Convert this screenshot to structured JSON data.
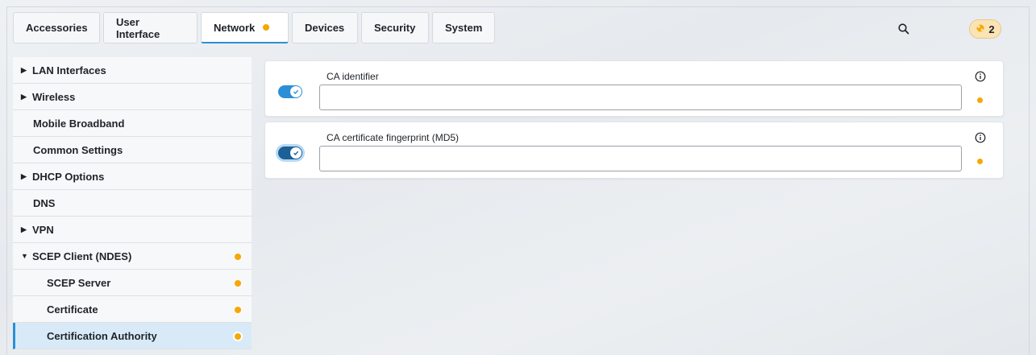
{
  "tabs": [
    {
      "label": "Accessories",
      "active": false,
      "modified": false
    },
    {
      "label": "User Interface",
      "active": false,
      "modified": false
    },
    {
      "label": "Network",
      "active": true,
      "modified": true
    },
    {
      "label": "Devices",
      "active": false,
      "modified": false
    },
    {
      "label": "Security",
      "active": false,
      "modified": false
    },
    {
      "label": "System",
      "active": false,
      "modified": false
    }
  ],
  "header": {
    "search_icon": "search-icon",
    "changes_count": "2"
  },
  "sidebar": {
    "items": [
      {
        "label": "LAN Interfaces",
        "expandable": "collapsed"
      },
      {
        "label": "Wireless",
        "expandable": "collapsed"
      },
      {
        "label": "Mobile Broadband"
      },
      {
        "label": "Common Settings"
      },
      {
        "label": "DHCP Options",
        "expandable": "collapsed"
      },
      {
        "label": "DNS"
      },
      {
        "label": "VPN",
        "expandable": "collapsed"
      },
      {
        "label": "SCEP Client (NDES)",
        "expandable": "expanded",
        "modified": true
      },
      {
        "label": "SCEP Server",
        "child": true,
        "modified": true
      },
      {
        "label": "Certificate",
        "child": true,
        "modified": true
      },
      {
        "label": "Certification Authority",
        "child": true,
        "modified": true,
        "selected": true
      }
    ]
  },
  "settings": [
    {
      "label": "CA identifier",
      "value": "",
      "enabled": true
    },
    {
      "label": "CA certificate fingerprint (MD5)",
      "value": "",
      "enabled": true
    }
  ],
  "colors": {
    "accent": "#2b8fd6",
    "modified_dot": "#f5a800",
    "selected_bg": "#d8eaf8"
  }
}
